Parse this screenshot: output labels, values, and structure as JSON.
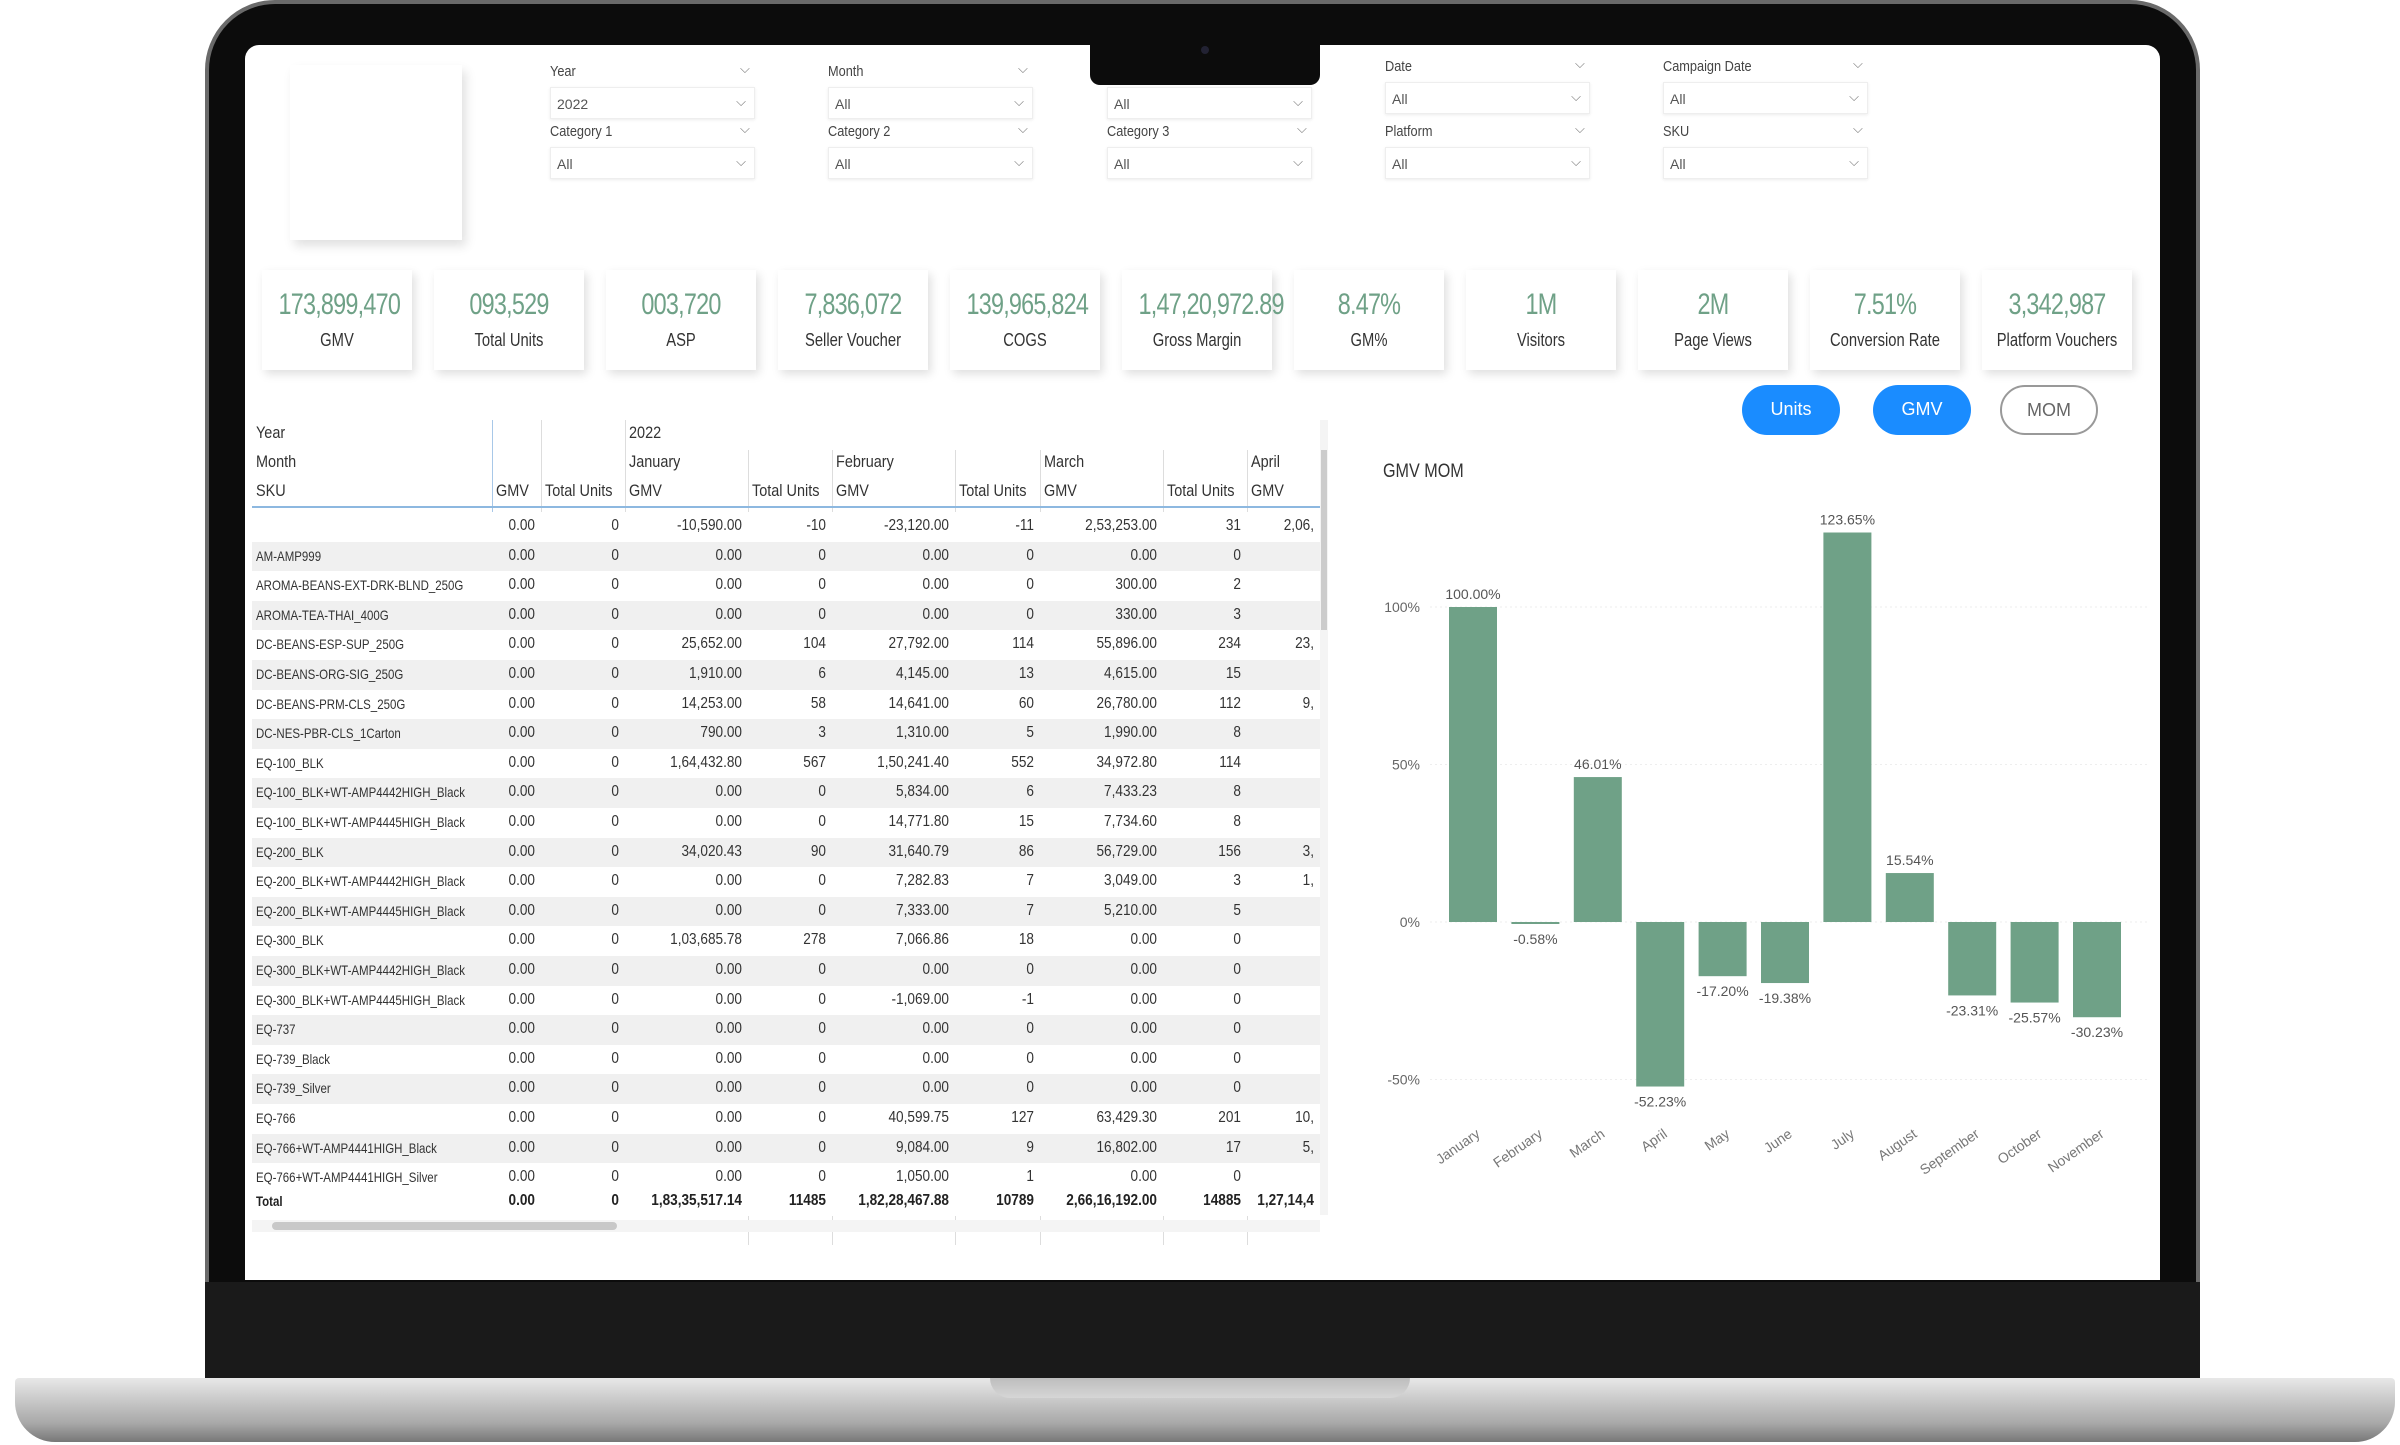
{
  "filters": [
    {
      "label": "Year",
      "value": "2022"
    },
    {
      "label": "Month",
      "value": "All"
    },
    {
      "label": "",
      "value": "All"
    },
    {
      "label": "Date",
      "value": "All"
    },
    {
      "label": "Campaign Date",
      "value": "All"
    },
    {
      "label": "Category 1",
      "value": "All"
    },
    {
      "label": "Category 2",
      "value": "All"
    },
    {
      "label": "Category 3",
      "value": "All"
    },
    {
      "label": "Platform",
      "value": "All"
    },
    {
      "label": "SKU",
      "value": "All"
    }
  ],
  "kpis": [
    {
      "value": "173,899,470",
      "label": "GMV"
    },
    {
      "value": "093,529",
      "label": "Total Units"
    },
    {
      "value": "003,720",
      "label": "ASP"
    },
    {
      "value": "7,836,072",
      "label": "Seller Voucher"
    },
    {
      "value": "139,965,824",
      "label": "COGS"
    },
    {
      "value": "1,47,20,972.89",
      "label": "Gross Margin"
    },
    {
      "value": "8.47%",
      "label": "GM%"
    },
    {
      "value": "1M",
      "label": "Visitors"
    },
    {
      "value": "2M",
      "label": "Page Views"
    },
    {
      "value": "7.51%",
      "label": "Conversion Rate"
    },
    {
      "value": "3,342,987",
      "label": "Platform Vouchers"
    }
  ],
  "toggles": {
    "units": "Units",
    "gmv": "GMV",
    "mom": "MOM"
  },
  "colors": {
    "accent": "#1a8cff",
    "bar": "#6fa187",
    "kpi": "#6fa187"
  },
  "table": {
    "row_headers": [
      "Year",
      "Month",
      "SKU"
    ],
    "year": "2022",
    "months": [
      "January",
      "February",
      "March",
      "April"
    ],
    "columns": [
      "GMV",
      "Total Units",
      "GMV",
      "Total Units",
      "GMV",
      "Total Units",
      "GMV",
      "Total Units",
      "GMV"
    ],
    "rows": [
      [
        "",
        "0.00",
        "0",
        "-10,590.00",
        "-10",
        "-23,120.00",
        "-11",
        "2,53,253.00",
        "31",
        "2,06,"
      ],
      [
        "AM-AMP999",
        "0.00",
        "0",
        "0.00",
        "0",
        "0.00",
        "0",
        "0.00",
        "0",
        ""
      ],
      [
        "AROMA-BEANS-EXT-DRK-BLND_250G",
        "0.00",
        "0",
        "0.00",
        "0",
        "0.00",
        "0",
        "300.00",
        "2",
        ""
      ],
      [
        "AROMA-TEA-THAI_400G",
        "0.00",
        "0",
        "0.00",
        "0",
        "0.00",
        "0",
        "330.00",
        "3",
        ""
      ],
      [
        "DC-BEANS-ESP-SUP_250G",
        "0.00",
        "0",
        "25,652.00",
        "104",
        "27,792.00",
        "114",
        "55,896.00",
        "234",
        "23,"
      ],
      [
        "DC-BEANS-ORG-SIG_250G",
        "0.00",
        "0",
        "1,910.00",
        "6",
        "4,145.00",
        "13",
        "4,615.00",
        "15",
        ""
      ],
      [
        "DC-BEANS-PRM-CLS_250G",
        "0.00",
        "0",
        "14,253.00",
        "58",
        "14,641.00",
        "60",
        "26,780.00",
        "112",
        "9,"
      ],
      [
        "DC-NES-PBR-CLS_1Carton",
        "0.00",
        "0",
        "790.00",
        "3",
        "1,310.00",
        "5",
        "1,990.00",
        "8",
        ""
      ],
      [
        "EQ-100_BLK",
        "0.00",
        "0",
        "1,64,432.80",
        "567",
        "1,50,241.40",
        "552",
        "34,972.80",
        "114",
        ""
      ],
      [
        "EQ-100_BLK+WT-AMP4442HIGH_Black",
        "0.00",
        "0",
        "0.00",
        "0",
        "5,834.00",
        "6",
        "7,433.23",
        "8",
        ""
      ],
      [
        "EQ-100_BLK+WT-AMP4445HIGH_Black",
        "0.00",
        "0",
        "0.00",
        "0",
        "14,771.80",
        "15",
        "7,734.60",
        "8",
        ""
      ],
      [
        "EQ-200_BLK",
        "0.00",
        "0",
        "34,020.43",
        "90",
        "31,640.79",
        "86",
        "56,729.00",
        "156",
        "3,"
      ],
      [
        "EQ-200_BLK+WT-AMP4442HIGH_Black",
        "0.00",
        "0",
        "0.00",
        "0",
        "7,282.83",
        "7",
        "3,049.00",
        "3",
        "1,"
      ],
      [
        "EQ-200_BLK+WT-AMP4445HIGH_Black",
        "0.00",
        "0",
        "0.00",
        "0",
        "7,333.00",
        "7",
        "5,210.00",
        "5",
        ""
      ],
      [
        "EQ-300_BLK",
        "0.00",
        "0",
        "1,03,685.78",
        "278",
        "7,066.86",
        "18",
        "0.00",
        "0",
        ""
      ],
      [
        "EQ-300_BLK+WT-AMP4442HIGH_Black",
        "0.00",
        "0",
        "0.00",
        "0",
        "0.00",
        "0",
        "0.00",
        "0",
        ""
      ],
      [
        "EQ-300_BLK+WT-AMP4445HIGH_Black",
        "0.00",
        "0",
        "0.00",
        "0",
        "-1,069.00",
        "-1",
        "0.00",
        "0",
        ""
      ],
      [
        "EQ-737",
        "0.00",
        "0",
        "0.00",
        "0",
        "0.00",
        "0",
        "0.00",
        "0",
        ""
      ],
      [
        "EQ-739_Black",
        "0.00",
        "0",
        "0.00",
        "0",
        "0.00",
        "0",
        "0.00",
        "0",
        ""
      ],
      [
        "EQ-739_Silver",
        "0.00",
        "0",
        "0.00",
        "0",
        "0.00",
        "0",
        "0.00",
        "0",
        ""
      ],
      [
        "EQ-766",
        "0.00",
        "0",
        "0.00",
        "0",
        "40,599.75",
        "127",
        "63,429.30",
        "201",
        "10,"
      ],
      [
        "EQ-766+WT-AMP4441HIGH_Black",
        "0.00",
        "0",
        "0.00",
        "0",
        "9,084.00",
        "9",
        "16,802.00",
        "17",
        "5,"
      ],
      [
        "EQ-766+WT-AMP4441HIGH_Silver",
        "0.00",
        "0",
        "0.00",
        "0",
        "1,050.00",
        "1",
        "0.00",
        "0",
        ""
      ]
    ],
    "total": [
      "Total",
      "0.00",
      "0",
      "1,83,35,517.14",
      "11485",
      "1,82,28,467.88",
      "10789",
      "2,66,16,192.00",
      "14885",
      "1,27,14,4"
    ]
  },
  "chart_data": {
    "type": "bar",
    "title": "GMV MOM",
    "categories": [
      "January",
      "February",
      "March",
      "April",
      "May",
      "June",
      "July",
      "August",
      "September",
      "October",
      "November"
    ],
    "values": [
      100.0,
      -0.58,
      46.01,
      -52.23,
      -17.2,
      -19.38,
      123.65,
      15.54,
      -23.31,
      -25.57,
      -30.23
    ],
    "data_labels": [
      "100.00%",
      "-0.58%",
      "46.01%",
      "-52.23%",
      "-17.20%",
      "-19.38%",
      "123.65%",
      "15.54%",
      "-23.31%",
      "-25.57%",
      "-30.23%"
    ],
    "yticks": [
      100,
      50,
      0,
      -50
    ],
    "ytick_labels": [
      "100%",
      "50%",
      "0%",
      "-50%"
    ],
    "ylim": [
      -60,
      130
    ],
    "grid": true,
    "color": "#6fa187"
  }
}
